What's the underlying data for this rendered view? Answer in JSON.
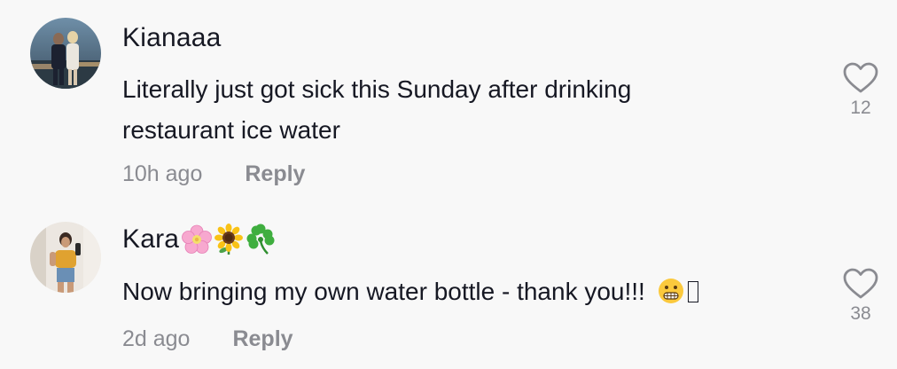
{
  "comments": [
    {
      "username": "Kianaaa",
      "text": "Literally just got sick this Sunday after drinking restaurant ice water",
      "time": "10h ago",
      "reply_label": "Reply",
      "like_count": "12",
      "avatar_icon": "user-photo",
      "username_emojis": []
    },
    {
      "username": "Kara",
      "text": "Now bringing my own water bottle - thank you!!!",
      "text_emojis": [
        "grimacing-face",
        "missing-glyph"
      ],
      "time": "2d ago",
      "reply_label": "Reply",
      "like_count": "38",
      "avatar_icon": "user-photo",
      "username_emojis": [
        "cherry-blossom",
        "sunflower",
        "shamrock"
      ]
    }
  ],
  "colors": {
    "background": "#f8f8f8",
    "text": "#161823",
    "muted": "#8a8b91",
    "heart_stroke": "#8a8b91"
  }
}
